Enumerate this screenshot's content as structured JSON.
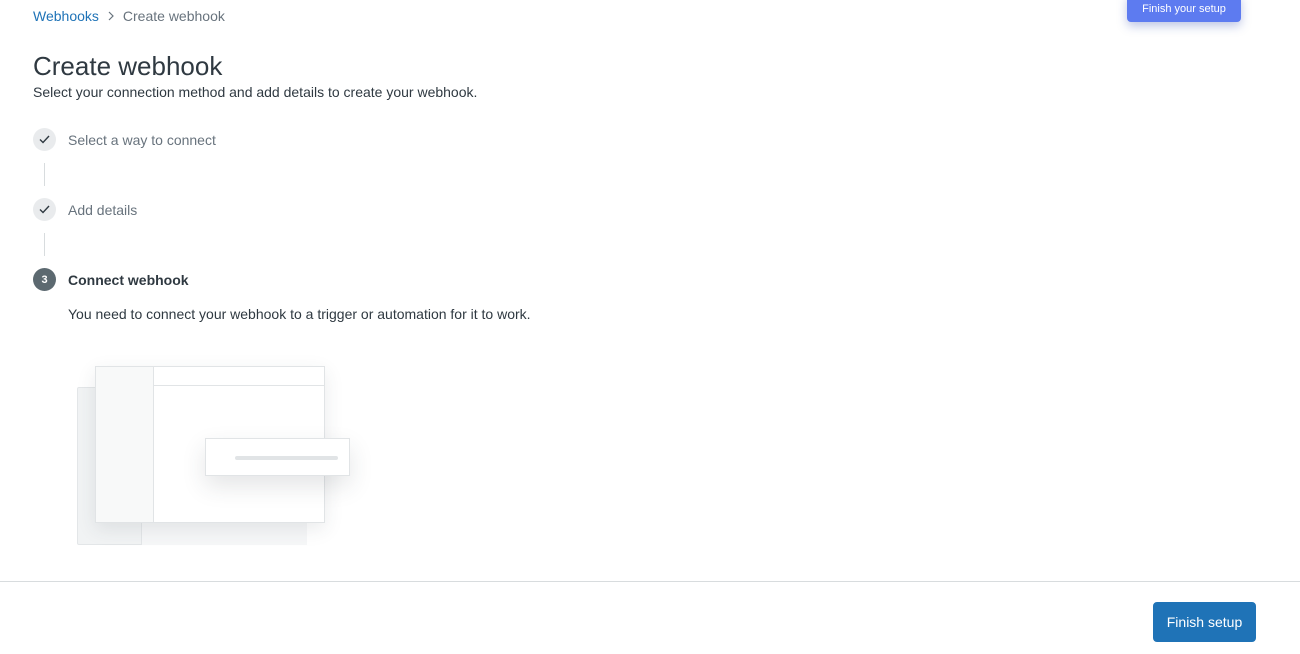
{
  "breadcrumb": {
    "parent_label": "Webhooks",
    "separator_icon": "chevron-right-icon",
    "current_label": "Create webhook"
  },
  "header": {
    "finish_your_setup_label": "Finish your setup",
    "accent_color": "#5d7bf0"
  },
  "page": {
    "title": "Create webhook",
    "subtitle": "Select your connection method and add details to create your webhook."
  },
  "steps": [
    {
      "number": "1",
      "label": "Select a way to connect",
      "status": "complete",
      "icon": "checkmark-icon"
    },
    {
      "number": "2",
      "label": "Add details",
      "status": "complete",
      "icon": "checkmark-icon"
    },
    {
      "number": "3",
      "label": "Connect webhook",
      "status": "active",
      "icon": ""
    }
  ],
  "active_step": {
    "description": "You need to connect your webhook to a trigger or automation for it to work."
  },
  "footer": {
    "finish_setup_label": "Finish setup",
    "primary_color": "#1f73b7"
  }
}
